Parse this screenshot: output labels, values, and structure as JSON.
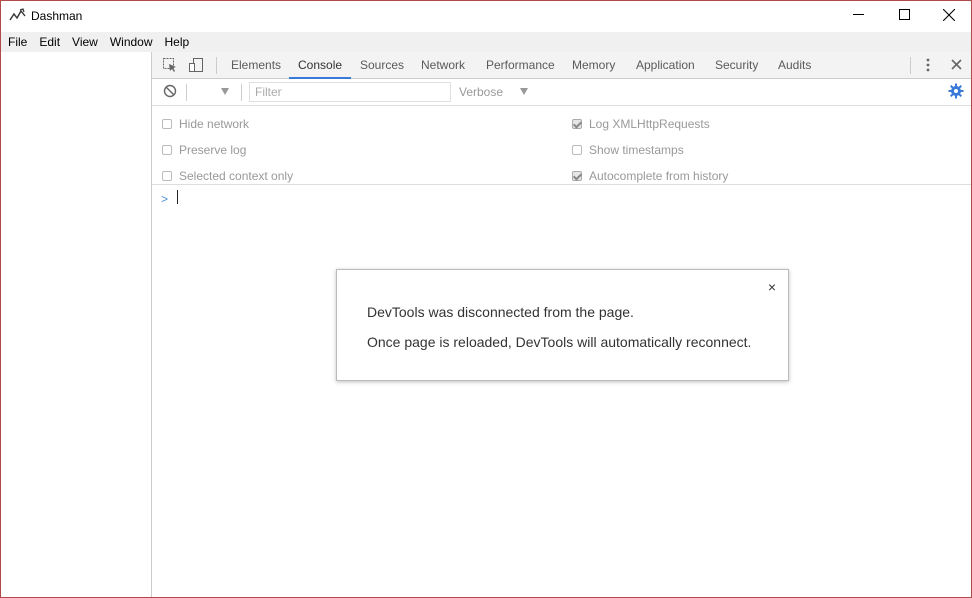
{
  "window": {
    "title": "Dashman",
    "minimize_icon": "minimize-icon",
    "maximize_icon": "maximize-icon",
    "close_icon": "close-icon"
  },
  "menubar": {
    "items": [
      "File",
      "Edit",
      "View",
      "Window",
      "Help"
    ]
  },
  "devtools": {
    "tabs": [
      {
        "label": "Elements",
        "active": false
      },
      {
        "label": "Console",
        "active": true
      },
      {
        "label": "Sources",
        "active": false
      },
      {
        "label": "Network",
        "active": false
      },
      {
        "label": "Performance",
        "active": false
      },
      {
        "label": "Memory",
        "active": false
      },
      {
        "label": "Application",
        "active": false
      },
      {
        "label": "Security",
        "active": false
      },
      {
        "label": "Audits",
        "active": false
      }
    ],
    "accent_color": "#3879d9",
    "toolbar": {
      "filter_placeholder": "Filter",
      "level": "Verbose"
    },
    "settings": {
      "hide_network": {
        "label": "Hide network",
        "checked": false
      },
      "preserve_log": {
        "label": "Preserve log",
        "checked": false
      },
      "selected_context": {
        "label": "Selected context only",
        "checked": false
      },
      "log_xhr": {
        "label": "Log XMLHttpRequests",
        "checked": true
      },
      "show_timestamps": {
        "label": "Show timestamps",
        "checked": false
      },
      "autocomplete": {
        "label": "Autocomplete from history",
        "checked": true
      }
    },
    "console": {
      "prompt": ">"
    }
  },
  "dialog": {
    "close_label": "×",
    "line1": "DevTools was disconnected from the page.",
    "line2": "Once page is reloaded, DevTools will automatically reconnect."
  }
}
